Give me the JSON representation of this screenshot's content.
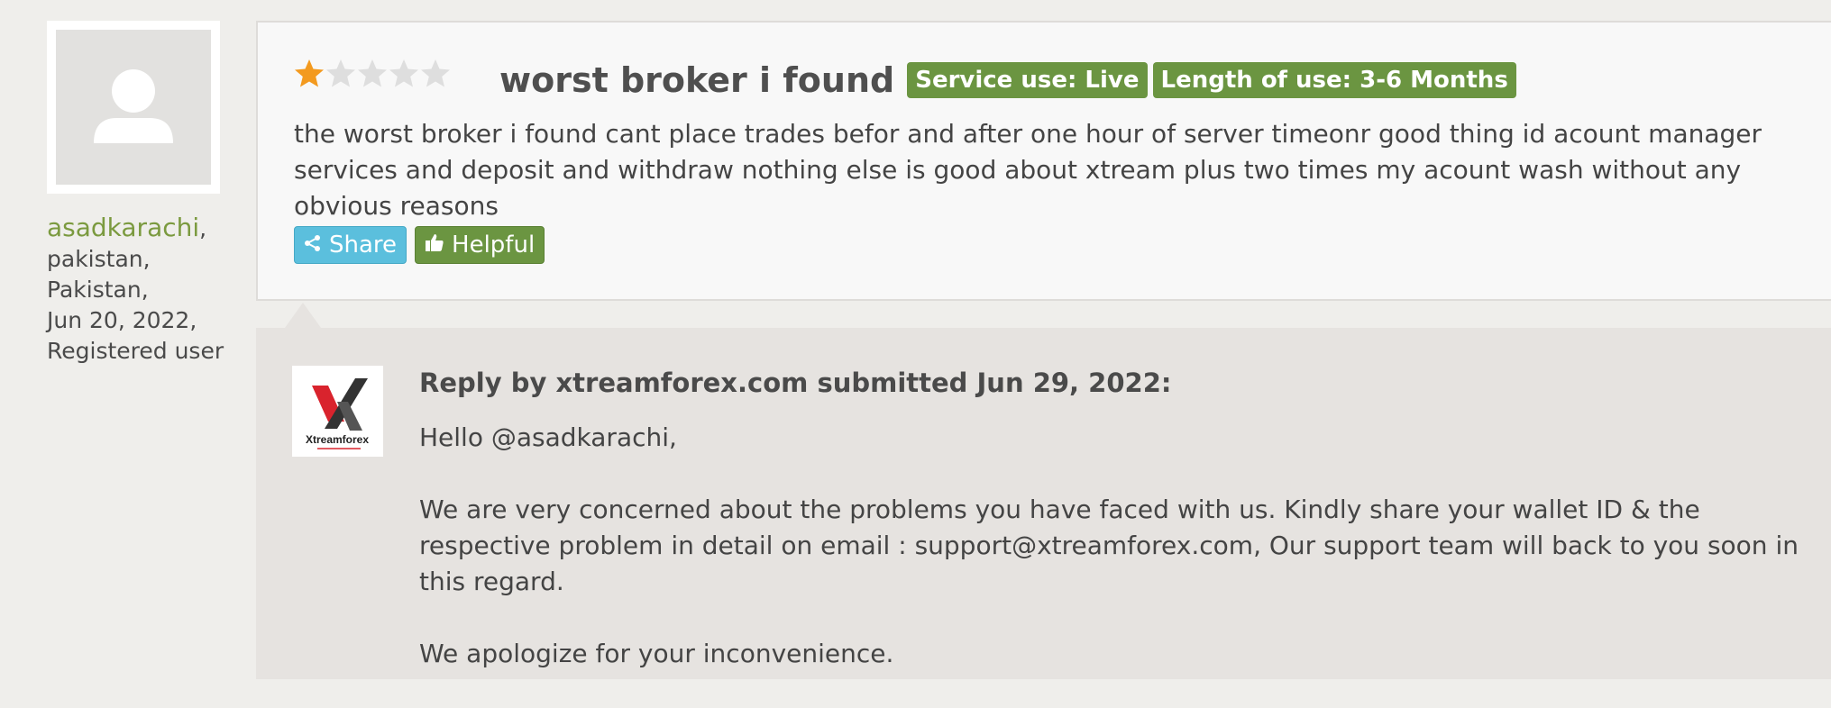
{
  "user": {
    "name": "asadkarachi",
    "city": "pakistan,",
    "country": "Pakistan,",
    "date": "Jun 20, 2022,",
    "status": "Registered user"
  },
  "review": {
    "rating": 1,
    "max_rating": 5,
    "title": "worst broker i found",
    "badges": [
      "Service use: Live",
      "Length of use: 3-6 Months"
    ],
    "text": "the worst broker i found cant place trades befor and after one hour of server timeonr good thing id acount manager services and deposit and withdraw nothing else is good about xtream plus two times my acount wash without any obvious reasons",
    "share_label": "Share",
    "helpful_label": "Helpful"
  },
  "reply": {
    "logo_text": "Xtreamforex",
    "heading": "Reply by xtreamforex.com submitted Jun 29, 2022:",
    "paragraphs": [
      "Hello @asadkarachi,",
      "We are very concerned about the problems you have faced with us. Kindly share your wallet ID & the respective problem in detail on email : support@xtreamforex.com, Our support team will back to you soon in this regard.",
      "We apologize for your inconvenience."
    ]
  },
  "colors": {
    "accent_green": "#6b9541",
    "share_blue": "#5bbfdd",
    "star_filled": "#f39a1f",
    "star_empty": "#dedede"
  },
  "icons": [
    "user-avatar-icon",
    "star-icon",
    "share-icon",
    "thumbs-up-icon",
    "xtreamforex-logo"
  ]
}
